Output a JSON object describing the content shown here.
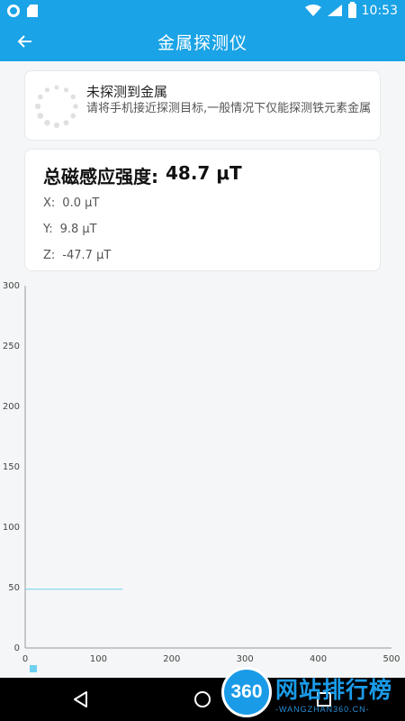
{
  "status_bar": {
    "time": "10:53"
  },
  "app_bar": {
    "title": "金属探测仪"
  },
  "status_card": {
    "title": "未探测到金属",
    "description": "请将手机接近探测目标,一般情况下仅能探测铁元素金属"
  },
  "field_card": {
    "title_label": "总磁感应强度:",
    "title_value": "48.7 μT",
    "x_label": "X:",
    "x_value": "0.0 μT",
    "y_label": "Y:",
    "y_value": "9.8 μT",
    "z_label": "Z:",
    "z_value": "-47.7 μT"
  },
  "chart_data": {
    "type": "line",
    "title": "",
    "xlabel": "",
    "ylabel": "",
    "xlim": [
      0,
      500
    ],
    "ylim": [
      0,
      300
    ],
    "x_ticks": [
      0,
      100,
      200,
      300,
      400,
      500
    ],
    "y_ticks": [
      0,
      50,
      100,
      150,
      200,
      250,
      300
    ],
    "series": [
      {
        "color": "#6ecff0",
        "x": [
          0,
          133
        ],
        "y": [
          48.7,
          48.7
        ]
      }
    ],
    "grid": false,
    "legend": "bottom-left"
  },
  "watermark": {
    "number": "360",
    "text": "网站排行榜",
    "url": "-WANGZHAN360.CN-"
  },
  "colors": {
    "primary": "#1aa3e6",
    "series": "#6ecff0"
  }
}
